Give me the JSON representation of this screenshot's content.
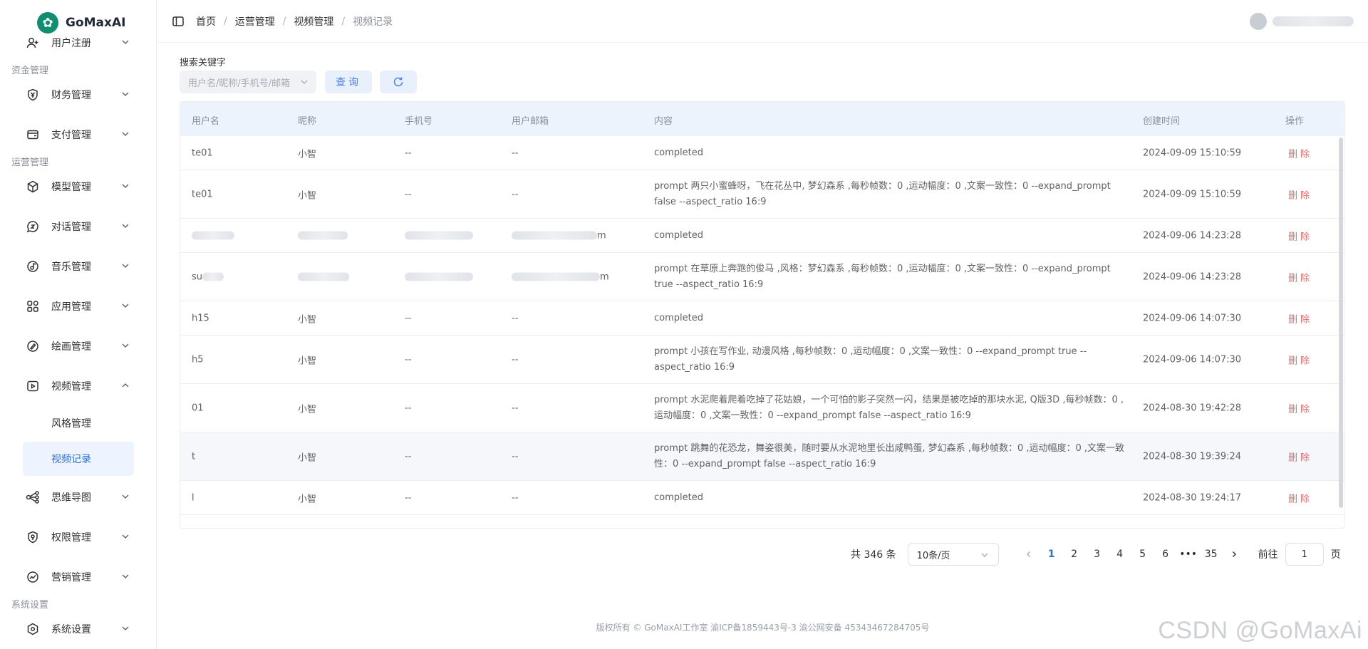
{
  "brand": {
    "name": "GoMaxAI"
  },
  "sidebar": {
    "groups": [
      "资金管理",
      "运营管理",
      "系统设置"
    ],
    "items": [
      {
        "label": "用户注册",
        "icon": "user-plus-icon"
      },
      {
        "label": "财务管理",
        "icon": "yen-shield-icon"
      },
      {
        "label": "支付管理",
        "icon": "wallet-icon"
      },
      {
        "label": "模型管理",
        "icon": "cube-icon"
      },
      {
        "label": "对话管理",
        "icon": "chat-icon"
      },
      {
        "label": "音乐管理",
        "icon": "music-icon"
      },
      {
        "label": "应用管理",
        "icon": "apps-icon"
      },
      {
        "label": "绘画管理",
        "icon": "brush-icon"
      },
      {
        "label": "视频管理",
        "icon": "video-icon"
      },
      {
        "label": "思维导图",
        "icon": "mindmap-icon"
      },
      {
        "label": "权限管理",
        "icon": "permission-icon"
      },
      {
        "label": "营销管理",
        "icon": "trend-icon"
      },
      {
        "label": "系统设置",
        "icon": "settings-icon"
      }
    ],
    "sub_items": [
      {
        "label": "风格管理"
      },
      {
        "label": "视频记录"
      }
    ]
  },
  "header": {
    "breadcrumb": [
      "首页",
      "运营管理",
      "视频管理",
      "视频记录"
    ]
  },
  "search": {
    "label": "搜索关键字",
    "placeholder": "用户名/昵称/手机号/邮箱",
    "query_label": "查询"
  },
  "table": {
    "columns": [
      "用户名",
      "昵称",
      "手机号",
      "用户邮箱",
      "内容",
      "创建时间",
      "操作"
    ],
    "rows": [
      {
        "username": "te01",
        "nickname": "小智",
        "phone": "--",
        "email": "--",
        "content": "completed",
        "created": "2024-09-09 15:10:59",
        "action": "删除"
      },
      {
        "username": "te01",
        "nickname": "小智",
        "phone": "--",
        "email": "--",
        "content": "prompt 两只小蜜蜂呀，飞在花丛中, 梦幻森系 ,每秒帧数：0 ,运动幅度：0 ,文案一致性：0 --expand_prompt false --aspect_ratio 16:9",
        "created": "2024-09-09 15:10:59",
        "action": "删除"
      },
      {
        "username": "",
        "nickname": "",
        "phone": "",
        "email": "m",
        "content": "completed",
        "created": "2024-09-06 14:23:28",
        "action": "删除"
      },
      {
        "username": "su",
        "nickname": "",
        "phone": "",
        "email": "m",
        "content": "prompt 在草原上奔跑的俊马 ,风格：梦幻森系 ,每秒帧数：0 ,运动幅度：0 ,文案一致性：0 --expand_prompt true --aspect_ratio 16:9",
        "created": "2024-09-06 14:23:28",
        "action": "删除"
      },
      {
        "username": "h15",
        "nickname": "小智",
        "phone": "--",
        "email": "--",
        "content": "completed",
        "created": "2024-09-06 14:07:30",
        "action": "删除"
      },
      {
        "username": "h5",
        "nickname": "小智",
        "phone": "--",
        "email": "--",
        "content": "prompt 小孩在写作业, 动漫风格 ,每秒帧数：0 ,运动幅度：0 ,文案一致性：0 --expand_prompt true --aspect_ratio 16:9",
        "created": "2024-09-06 14:07:30",
        "action": "删除"
      },
      {
        "username": "01",
        "nickname": "小智",
        "phone": "--",
        "email": "--",
        "content": "prompt 水泥爬着爬着吃掉了花姑娘，一个可怕的影子突然一闪，结果是被吃掉的那块水泥, Q版3D ,每秒帧数：0 ,运动幅度：0 ,文案一致性：0 --expand_prompt false --aspect_ratio 16:9",
        "created": "2024-08-30 19:42:28",
        "action": "删除"
      },
      {
        "username": "t",
        "nickname": "小智",
        "phone": "--",
        "email": "--",
        "content": "prompt 跳舞的花恐龙，舞姿很美，随时要从水泥地里长出咸鸭蛋, 梦幻森系 ,每秒帧数：0 ,运动幅度：0 ,文案一致性：0 --expand_prompt false --aspect_ratio 16:9",
        "created": "2024-08-30 19:39:24",
        "action": "删除"
      },
      {
        "username": "l",
        "nickname": "小智",
        "phone": "--",
        "email": "--",
        "content": "completed",
        "created": "2024-08-30 19:24:17",
        "action": "删除"
      }
    ]
  },
  "pagination": {
    "total": "共 346 条",
    "page_size": "10条/页",
    "pages": [
      "1",
      "2",
      "3",
      "4",
      "5",
      "6",
      "•••",
      "35"
    ],
    "goto_label": "前往",
    "goto_value": "1",
    "page_unit": "页"
  },
  "footer": {
    "text": "版权所有 © GoMaxAI工作室   渝ICP备1859443号-3   渝公网安备 45343467284705号"
  },
  "watermark": "CSDN @GoMaxAi"
}
